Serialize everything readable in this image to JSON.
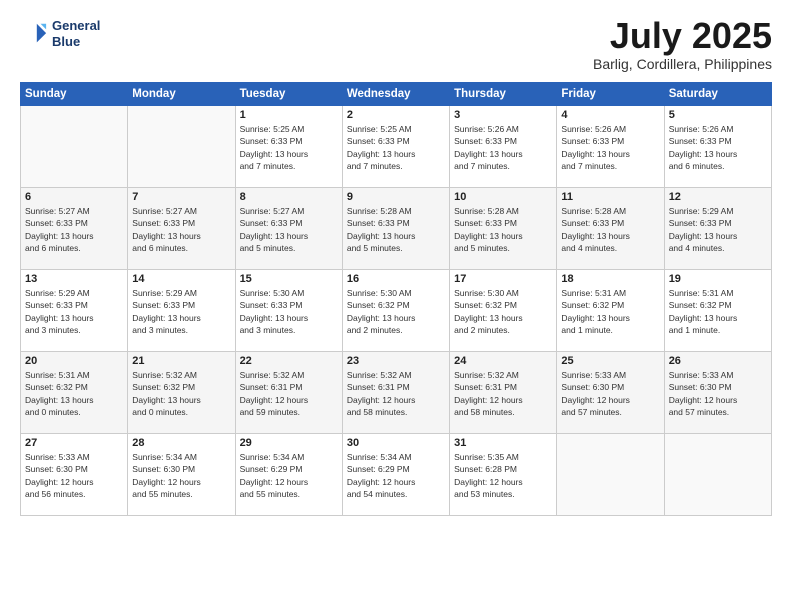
{
  "logo": {
    "line1": "General",
    "line2": "Blue"
  },
  "title": "July 2025",
  "subtitle": "Barlig, Cordillera, Philippines",
  "weekdays": [
    "Sunday",
    "Monday",
    "Tuesday",
    "Wednesday",
    "Thursday",
    "Friday",
    "Saturday"
  ],
  "rows": [
    [
      {
        "num": "",
        "info": ""
      },
      {
        "num": "",
        "info": ""
      },
      {
        "num": "1",
        "info": "Sunrise: 5:25 AM\nSunset: 6:33 PM\nDaylight: 13 hours\nand 7 minutes."
      },
      {
        "num": "2",
        "info": "Sunrise: 5:25 AM\nSunset: 6:33 PM\nDaylight: 13 hours\nand 7 minutes."
      },
      {
        "num": "3",
        "info": "Sunrise: 5:26 AM\nSunset: 6:33 PM\nDaylight: 13 hours\nand 7 minutes."
      },
      {
        "num": "4",
        "info": "Sunrise: 5:26 AM\nSunset: 6:33 PM\nDaylight: 13 hours\nand 7 minutes."
      },
      {
        "num": "5",
        "info": "Sunrise: 5:26 AM\nSunset: 6:33 PM\nDaylight: 13 hours\nand 6 minutes."
      }
    ],
    [
      {
        "num": "6",
        "info": "Sunrise: 5:27 AM\nSunset: 6:33 PM\nDaylight: 13 hours\nand 6 minutes."
      },
      {
        "num": "7",
        "info": "Sunrise: 5:27 AM\nSunset: 6:33 PM\nDaylight: 13 hours\nand 6 minutes."
      },
      {
        "num": "8",
        "info": "Sunrise: 5:27 AM\nSunset: 6:33 PM\nDaylight: 13 hours\nand 5 minutes."
      },
      {
        "num": "9",
        "info": "Sunrise: 5:28 AM\nSunset: 6:33 PM\nDaylight: 13 hours\nand 5 minutes."
      },
      {
        "num": "10",
        "info": "Sunrise: 5:28 AM\nSunset: 6:33 PM\nDaylight: 13 hours\nand 5 minutes."
      },
      {
        "num": "11",
        "info": "Sunrise: 5:28 AM\nSunset: 6:33 PM\nDaylight: 13 hours\nand 4 minutes."
      },
      {
        "num": "12",
        "info": "Sunrise: 5:29 AM\nSunset: 6:33 PM\nDaylight: 13 hours\nand 4 minutes."
      }
    ],
    [
      {
        "num": "13",
        "info": "Sunrise: 5:29 AM\nSunset: 6:33 PM\nDaylight: 13 hours\nand 3 minutes."
      },
      {
        "num": "14",
        "info": "Sunrise: 5:29 AM\nSunset: 6:33 PM\nDaylight: 13 hours\nand 3 minutes."
      },
      {
        "num": "15",
        "info": "Sunrise: 5:30 AM\nSunset: 6:33 PM\nDaylight: 13 hours\nand 3 minutes."
      },
      {
        "num": "16",
        "info": "Sunrise: 5:30 AM\nSunset: 6:32 PM\nDaylight: 13 hours\nand 2 minutes."
      },
      {
        "num": "17",
        "info": "Sunrise: 5:30 AM\nSunset: 6:32 PM\nDaylight: 13 hours\nand 2 minutes."
      },
      {
        "num": "18",
        "info": "Sunrise: 5:31 AM\nSunset: 6:32 PM\nDaylight: 13 hours\nand 1 minute."
      },
      {
        "num": "19",
        "info": "Sunrise: 5:31 AM\nSunset: 6:32 PM\nDaylight: 13 hours\nand 1 minute."
      }
    ],
    [
      {
        "num": "20",
        "info": "Sunrise: 5:31 AM\nSunset: 6:32 PM\nDaylight: 13 hours\nand 0 minutes."
      },
      {
        "num": "21",
        "info": "Sunrise: 5:32 AM\nSunset: 6:32 PM\nDaylight: 13 hours\nand 0 minutes."
      },
      {
        "num": "22",
        "info": "Sunrise: 5:32 AM\nSunset: 6:31 PM\nDaylight: 12 hours\nand 59 minutes."
      },
      {
        "num": "23",
        "info": "Sunrise: 5:32 AM\nSunset: 6:31 PM\nDaylight: 12 hours\nand 58 minutes."
      },
      {
        "num": "24",
        "info": "Sunrise: 5:32 AM\nSunset: 6:31 PM\nDaylight: 12 hours\nand 58 minutes."
      },
      {
        "num": "25",
        "info": "Sunrise: 5:33 AM\nSunset: 6:30 PM\nDaylight: 12 hours\nand 57 minutes."
      },
      {
        "num": "26",
        "info": "Sunrise: 5:33 AM\nSunset: 6:30 PM\nDaylight: 12 hours\nand 57 minutes."
      }
    ],
    [
      {
        "num": "27",
        "info": "Sunrise: 5:33 AM\nSunset: 6:30 PM\nDaylight: 12 hours\nand 56 minutes."
      },
      {
        "num": "28",
        "info": "Sunrise: 5:34 AM\nSunset: 6:30 PM\nDaylight: 12 hours\nand 55 minutes."
      },
      {
        "num": "29",
        "info": "Sunrise: 5:34 AM\nSunset: 6:29 PM\nDaylight: 12 hours\nand 55 minutes."
      },
      {
        "num": "30",
        "info": "Sunrise: 5:34 AM\nSunset: 6:29 PM\nDaylight: 12 hours\nand 54 minutes."
      },
      {
        "num": "31",
        "info": "Sunrise: 5:35 AM\nSunset: 6:28 PM\nDaylight: 12 hours\nand 53 minutes."
      },
      {
        "num": "",
        "info": ""
      },
      {
        "num": "",
        "info": ""
      }
    ]
  ]
}
